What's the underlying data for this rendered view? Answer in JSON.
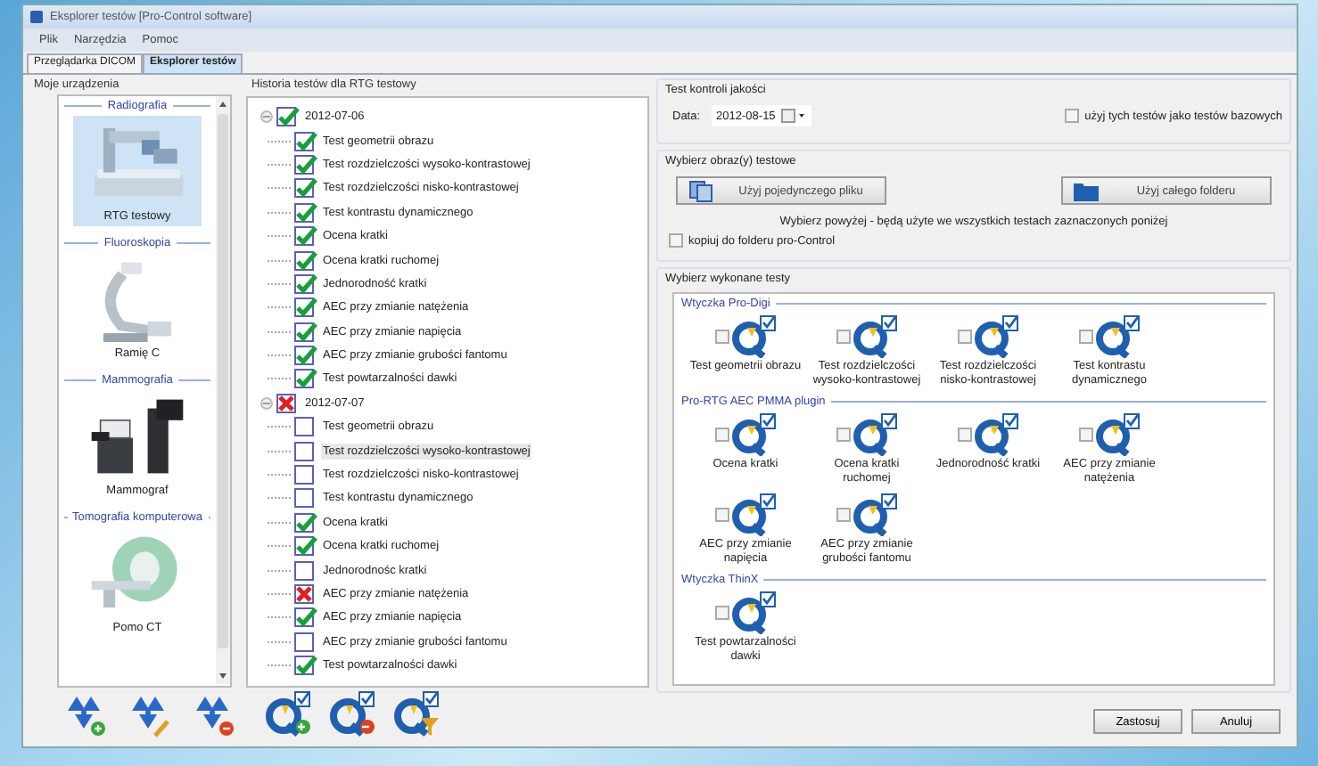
{
  "window": {
    "title": "Eksplorer testów [Pro-Control software]"
  },
  "menu": [
    "Plik",
    "Narzędzia",
    "Pomoc"
  ],
  "tabs": [
    {
      "label": "Przeglądarka DICOM",
      "selected": false
    },
    {
      "label": "Eksplorer testów",
      "selected": true
    }
  ],
  "devices_panel": {
    "title": "Moje urządzenia",
    "groups": [
      {
        "heading": "Radiografia",
        "device": {
          "label": "RTG testowy",
          "kind": "radiography",
          "selected": true
        }
      },
      {
        "heading": "Fluoroskopia",
        "device": {
          "label": "Ramię C",
          "kind": "carm",
          "selected": false
        }
      },
      {
        "heading": "Mammografia",
        "device": {
          "label": "Mammograf",
          "kind": "mammography",
          "selected": false
        }
      },
      {
        "heading": "Tomografia komputerowa",
        "device": {
          "label": "Pomo CT",
          "kind": "ct",
          "selected": false
        }
      }
    ],
    "actions": [
      {
        "kind": "add"
      },
      {
        "kind": "edit"
      },
      {
        "kind": "remove"
      }
    ]
  },
  "history": {
    "title": "Historia testów dla RTG testowy",
    "tree": [
      {
        "label": "2012-07-06",
        "kind": "passed",
        "expanded": true,
        "children": [
          {
            "label": "Test geometrii obrazu",
            "kind": "passed",
            "selected": false
          },
          {
            "label": "Test rozdzielczości wysoko-kontrastowej",
            "kind": "passed",
            "selected": false
          },
          {
            "label": "Test rozdzielczości nisko-kontrastowej",
            "kind": "passed",
            "selected": false
          },
          {
            "label": "Test kontrastu dynamicznego",
            "kind": "passed",
            "selected": false
          },
          {
            "label": "Ocena kratki",
            "kind": "passed",
            "selected": false
          },
          {
            "label": "Ocena kratki ruchomej",
            "kind": "passed",
            "selected": false
          },
          {
            "label": "Jednorodność kratki",
            "kind": "passed",
            "selected": false
          },
          {
            "label": "AEC przy zmianie natężenia",
            "kind": "passed",
            "selected": false
          },
          {
            "label": "AEC przy zmianie napięcia",
            "kind": "passed",
            "selected": false
          },
          {
            "label": "AEC przy zmianie grubości fantomu",
            "kind": "passed",
            "selected": false
          },
          {
            "label": "Test powtarzalności dawki",
            "kind": "passed",
            "selected": false
          }
        ]
      },
      {
        "label": "2012-07-07",
        "kind": "failed",
        "expanded": true,
        "children": [
          {
            "label": "Test geometrii obrazu",
            "kind": "empty",
            "selected": false
          },
          {
            "label": "Test rozdzielczości wysoko-kontrastowej",
            "kind": "empty",
            "selected": true
          },
          {
            "label": "Test rozdzielczości nisko-kontrastowej",
            "kind": "empty",
            "selected": false
          },
          {
            "label": "Test kontrastu dynamicznego",
            "kind": "empty",
            "selected": false
          },
          {
            "label": "Ocena kratki",
            "kind": "passed",
            "selected": false
          },
          {
            "label": "Ocena kratki ruchomej",
            "kind": "passed",
            "selected": false
          },
          {
            "label": "Jednorodnośc kratki",
            "kind": "empty",
            "selected": false
          },
          {
            "label": "AEC przy zmianie natężenia",
            "kind": "failed",
            "selected": false
          },
          {
            "label": "AEC przy zmianie napięcia",
            "kind": "passed",
            "selected": false
          },
          {
            "label": "AEC przy zmianie grubości fantomu",
            "kind": "empty",
            "selected": false
          },
          {
            "label": "Test powtarzalności dawki",
            "kind": "passed",
            "selected": false
          }
        ]
      }
    ],
    "actions": [
      {
        "kind": "add"
      },
      {
        "kind": "remove"
      },
      {
        "kind": "filter"
      }
    ]
  },
  "qc_test": {
    "title": "Test kontroli jakości",
    "date_label": "Data:",
    "date": "2012-08-15",
    "baseline": {
      "label": "użyj tych testów jako testów bazowych",
      "checked": false
    }
  },
  "images": {
    "title": "Wybierz obraz(y) testowe",
    "buttons": [
      {
        "label": "Użyj pojedynczego pliku",
        "kind": "file"
      },
      {
        "label": "Użyj całego folderu",
        "kind": "folder"
      }
    ],
    "note": "Wybierz powyżej - będą użyte we wszystkich testach zaznaczonych poniżej",
    "copy": {
      "label": "kopiuj do folderu pro-Control",
      "checked": false
    }
  },
  "tests": {
    "title": "Wybierz wykonane testy",
    "plugins": [
      {
        "name": "Wtyczka Pro-Digi",
        "items": [
          {
            "label": "Test geometrii obrazu",
            "checked": false
          },
          {
            "label": "Test rozdzielczości wysoko-kontrastowej",
            "checked": false
          },
          {
            "label": "Test rozdzielczości nisko-kontrastowej",
            "checked": false
          },
          {
            "label": "Test kontrastu dynamicznego",
            "checked": false
          }
        ]
      },
      {
        "name": "Pro-RTG AEC PMMA plugin",
        "items": [
          {
            "label": "Ocena kratki",
            "checked": false
          },
          {
            "label": "Ocena kratki ruchomej",
            "checked": false
          },
          {
            "label": "Jednorodność kratki",
            "checked": false
          },
          {
            "label": "AEC przy zmianie natężenia",
            "checked": false
          },
          {
            "label": "AEC przy zmianie napięcia",
            "checked": false
          },
          {
            "label": "AEC przy zmianie grubości fantomu",
            "checked": false
          }
        ]
      },
      {
        "name": "Wtyczka ThinX",
        "items": [
          {
            "label": "Test powtarzalności dawki",
            "checked": false
          }
        ]
      }
    ]
  },
  "footer_buttons": [
    "Zastosuj",
    "Anuluj"
  ]
}
